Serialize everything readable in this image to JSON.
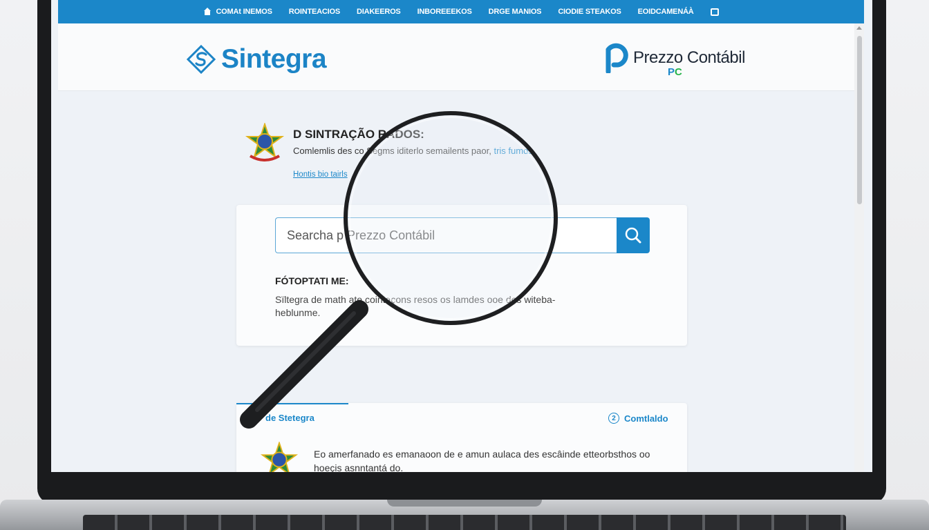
{
  "nav": {
    "items": [
      "COMAt INEMOS",
      "ROINTEACIOS",
      "DIAKEEROS",
      "INBOREEEKOS",
      "DRGE MANIOS",
      "CIODIE STEAKOS",
      "EOIDCAMENÁÀ"
    ],
    "home_icon": "home-icon",
    "end_icon": "cart-icon"
  },
  "header": {
    "brand_name": "Sintegra",
    "partner_name": "Prezzo Contábil",
    "partner_mark_p": "P",
    "partner_mark_c": "C"
  },
  "intro": {
    "title": "D SINTRAÇÃO RADOS:",
    "desc_prefix": "Comlemlis des co",
    "desc_mid": "  Segms iditerlo semailents paor,",
    "desc_suffix": "  tris fumds",
    "link": "Hontis bio tairls"
  },
  "search": {
    "value": "Searcha p Prezzo Contábil",
    "heading": "FÓTOPTATI ME:",
    "text": "Sïltegra de math  ate cointaçons resos  os lamdes ooe des witeba-heblunme."
  },
  "tabs": {
    "left_label": "de Stetegra",
    "right_number": "2",
    "right_label": "Comtlaldo",
    "body_text": "Eo amerfanado es emanaoon de e amun aulaca des escâinde etteorbsthos oo hoeçis asnntantá do."
  },
  "colors": {
    "accent": "#1b87c9",
    "partner_green": "#26b34a",
    "emblem_red": "#c8302c",
    "emblem_green": "#2e8b3a",
    "emblem_gold": "#e0b21b"
  }
}
